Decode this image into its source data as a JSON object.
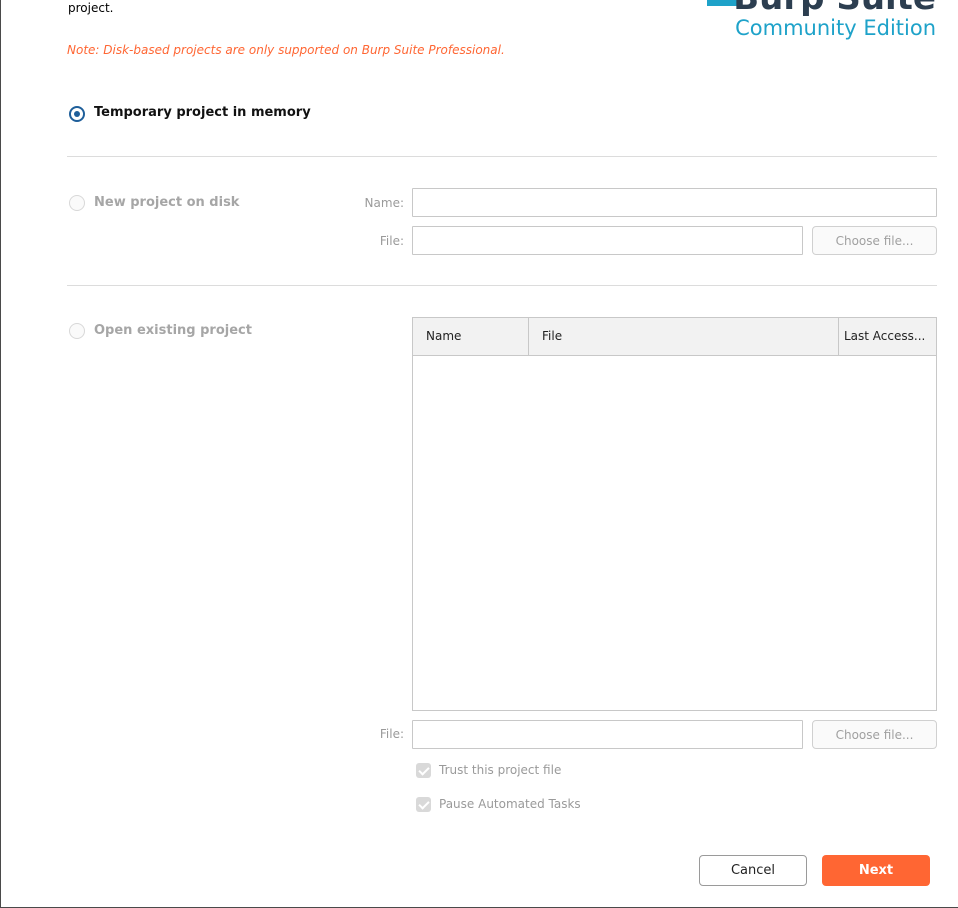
{
  "intro": {
    "text": "project."
  },
  "note": {
    "text": "Note: Disk-based projects are only supported on Burp Suite Professional."
  },
  "logo": {
    "wordmark": "Burp Suite",
    "edition": "Community Edition",
    "brand_color": "#1ea2c9"
  },
  "options": {
    "temporary": {
      "label": "Temporary project in memory",
      "selected": true
    },
    "new_disk": {
      "label": "New project on disk",
      "selected": false,
      "name_label": "Name:",
      "name_value": "",
      "file_label": "File:",
      "file_value": "",
      "choose_label": "Choose file..."
    },
    "open_existing": {
      "label": "Open existing project",
      "selected": false,
      "columns": [
        "Name",
        "File",
        "Last Access..."
      ],
      "rows": [],
      "file_label": "File:",
      "file_value": "",
      "choose_label": "Choose file...",
      "trust_label": "Trust this project file",
      "trust_checked": true,
      "pause_label": "Pause Automated Tasks",
      "pause_checked": true
    }
  },
  "footer": {
    "cancel_label": "Cancel",
    "next_label": "Next"
  },
  "colors": {
    "accent": "#ff6633",
    "radio_selected": "#1f5f9a"
  }
}
